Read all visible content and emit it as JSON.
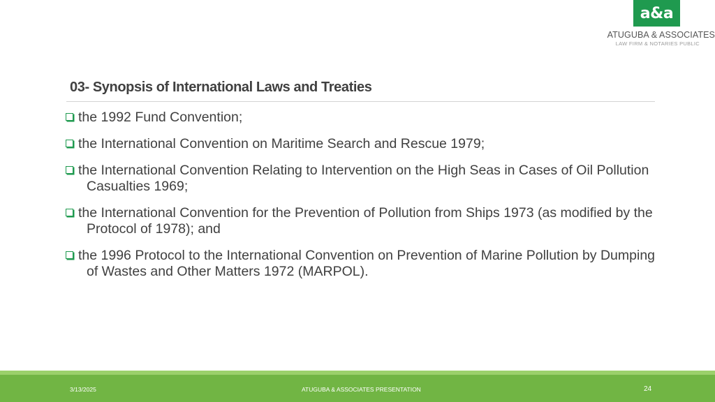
{
  "logo": {
    "mark": "a&a",
    "name": "ATUGUBA & ASSOCIATES",
    "tagline": "LAW FIRM & NOTARIES PUBLIC"
  },
  "slide": {
    "title": "03- Synopsis of International Laws and Treaties",
    "bullets": [
      "the 1992 Fund Convention;",
      "the International Convention on Maritime Search and Rescue 1979;",
      "the International Convention Relating to Intervention on the High Seas in Cases of Oil Pollution Casualties 1969;",
      "the International Convention for the Prevention of Pollution from Ships 1973 (as modified by the Protocol of 1978); and",
      "the 1996 Protocol to the International Convention on Prevention of Marine Pollution by Dumping of Wastes and Other Matters 1972 (MARPOL)."
    ]
  },
  "footer": {
    "date": "3/13/2025",
    "center": "ATUGUBA & ASSOCIATES PRESENTATION",
    "page": "24"
  },
  "colors": {
    "brand_green": "#1f9a4f",
    "footer_green": "#71b544",
    "footer_light_green": "#9bd06b",
    "text": "#404040"
  }
}
